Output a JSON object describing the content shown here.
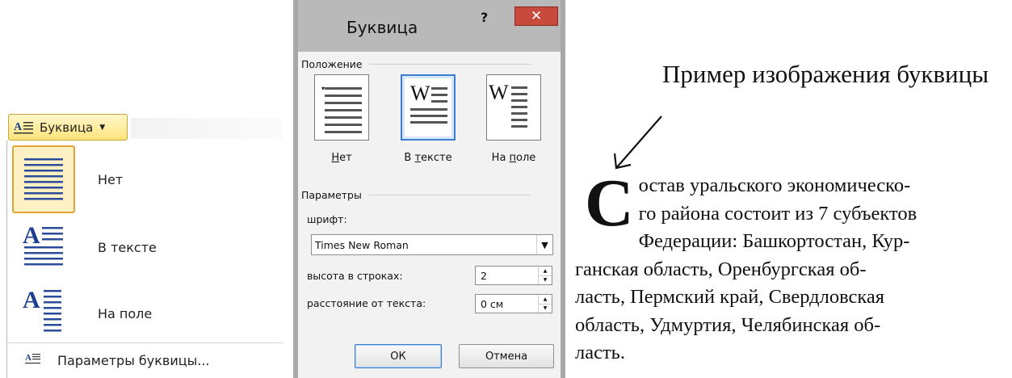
{
  "menu": {
    "button_label": "Буквица",
    "items": [
      {
        "label": "Нет"
      },
      {
        "label": "В тексте"
      },
      {
        "label": "На поле"
      }
    ],
    "footer_label": "Параметры буквицы..."
  },
  "dialog": {
    "title": "Буквица",
    "help": "?",
    "close": "✕",
    "position_group": "Положение",
    "positions": [
      {
        "pre": "",
        "key": "Н",
        "post": "ет"
      },
      {
        "pre": "В ",
        "key": "т",
        "post": "ексте"
      },
      {
        "pre": "На ",
        "key": "п",
        "post": "оле"
      }
    ],
    "params_group": "Параметры",
    "font_label": "шрифт:",
    "font_value": "Times New Roman",
    "height_label": "высота в строках:",
    "height_value": "2",
    "distance_label": "расстояние от текста:",
    "distance_value": "0 см",
    "ok": "ОК",
    "cancel": "Отмена"
  },
  "example": {
    "caption": "Пример изображения буквицы",
    "drop_cap": "С",
    "lines": [
      "остав уральского экономическо-",
      "го района состоит из 7 субъектов",
      "Федерации: Башкортостан, Кур-",
      "ганская область, Оренбургская об-",
      "ласть, Пермский край, Свердловская",
      "область, Удмуртия, Челябинская об-",
      "ласть."
    ]
  }
}
